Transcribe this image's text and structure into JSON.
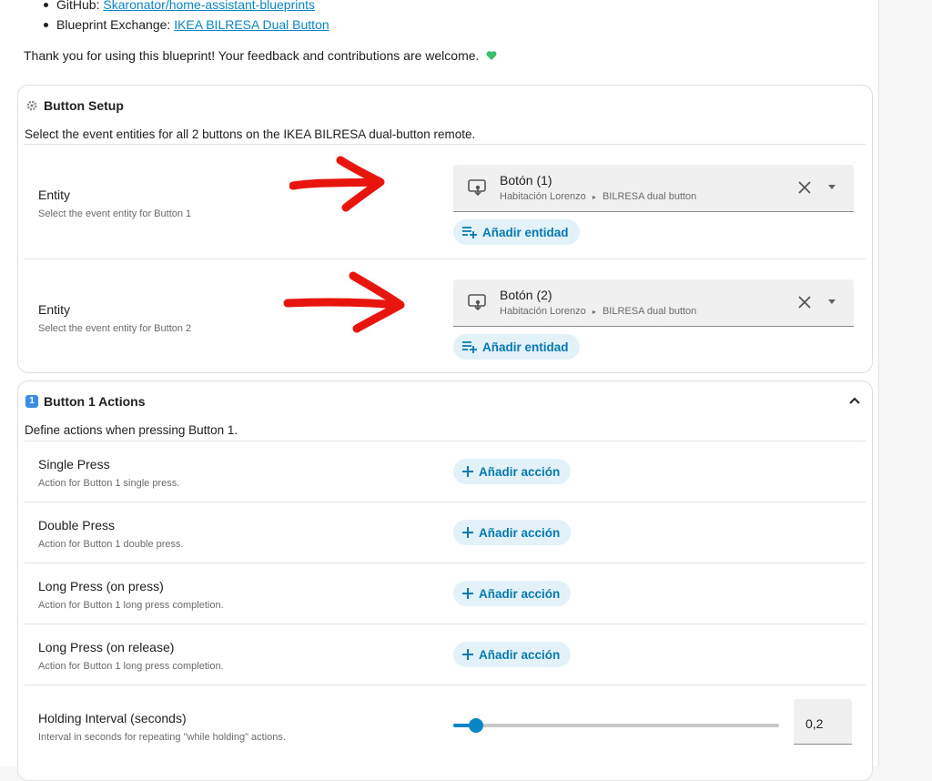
{
  "intro": {
    "github_label": "GitHub: ",
    "github_link": "Skaronator/home-assistant-blueprints",
    "exchange_label": "Blueprint Exchange: ",
    "exchange_link": "IKEA BILRESA Dual Button",
    "thanks": "Thank you for using this blueprint! Your feedback and contributions are welcome."
  },
  "button_setup": {
    "title": "Button Setup",
    "description": "Select the event entities for all 2 buttons on the IKEA BILRESA dual-button remote.",
    "rows": [
      {
        "label": "Entity",
        "help": "Select the event entity for Button 1",
        "entity_name": "Botón (1)",
        "entity_area": "Habitación Lorenzo",
        "entity_device": "BILRESA dual button",
        "add_label": "Añadir entidad"
      },
      {
        "label": "Entity",
        "help": "Select the event entity for Button 2",
        "entity_name": "Botón (2)",
        "entity_area": "Habitación Lorenzo",
        "entity_device": "BILRESA dual button",
        "add_label": "Añadir entidad"
      }
    ]
  },
  "button1_actions": {
    "badge": "1",
    "title": "Button 1 Actions",
    "description": "Define actions when pressing Button 1.",
    "rows": [
      {
        "label": "Single Press",
        "help": "Action for Button 1 single press.",
        "add_label": "Añadir acción"
      },
      {
        "label": "Double Press",
        "help": "Action for Button 1 double press.",
        "add_label": "Añadir acción"
      },
      {
        "label": "Long Press (on press)",
        "help": "Action for Button 1 long press completion.",
        "add_label": "Añadir acción"
      },
      {
        "label": "Long Press (on release)",
        "help": "Action for Button 1 long press completion.",
        "add_label": "Añadir acción"
      }
    ],
    "holding": {
      "label": "Holding Interval (seconds)",
      "help": "Interval in seconds for repeating \"while holding\" actions.",
      "value": "0,2",
      "slider_fraction": 0.07
    }
  },
  "colors": {
    "accent": "#0a86c4",
    "chip_bg": "#e3f1f9",
    "annotation_arrow": "#e8150f",
    "heart": "#3cbf6a"
  }
}
